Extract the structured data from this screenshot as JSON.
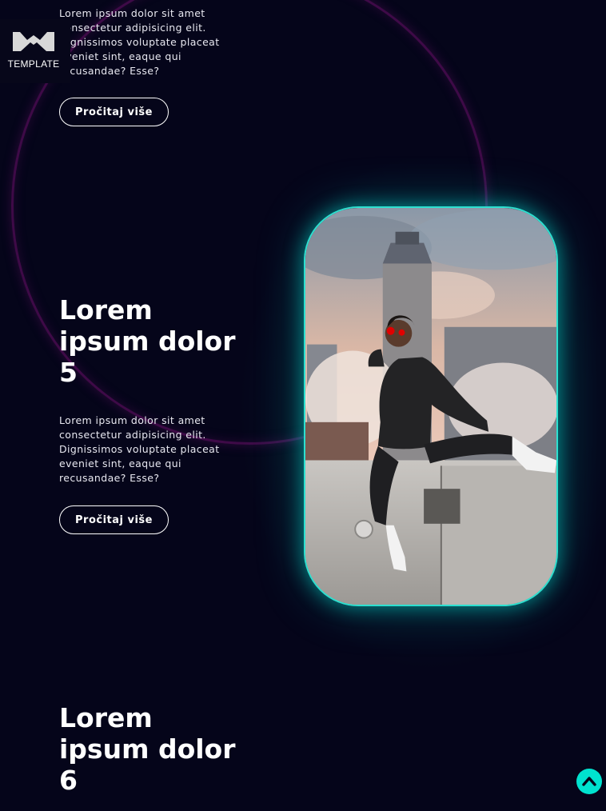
{
  "brand": {
    "logo_text": "TEMPLATE",
    "logo_icon": "template-logo-icon"
  },
  "sections": [
    {
      "description": "Lorem ipsum dolor sit amet\nconsectetur adipisicing elit.\nDignissimos voluptate placeat\neveniet sint, eaque qui\nrecusandae? Esse?",
      "button_label": "Pročitaj više"
    },
    {
      "title": "Lorem\nipsum dolor\n5",
      "description": "Lorem ipsum dolor sit amet\nconsectetur adipisicing elit.\nDignissimos voluptate placeat\neveniet sint, eaque qui\nrecusandae? Esse?",
      "button_label": "Pročitaj više",
      "image_alt": "woman-sitting-on-rooftop-photo"
    },
    {
      "title": "Lorem\nipsum dolor\n6"
    }
  ],
  "scroll_top": {
    "icon": "chevron-up-icon"
  },
  "colors": {
    "background": "#05051a",
    "accent": "#00e2cf",
    "ring": "#6e0e6e"
  }
}
